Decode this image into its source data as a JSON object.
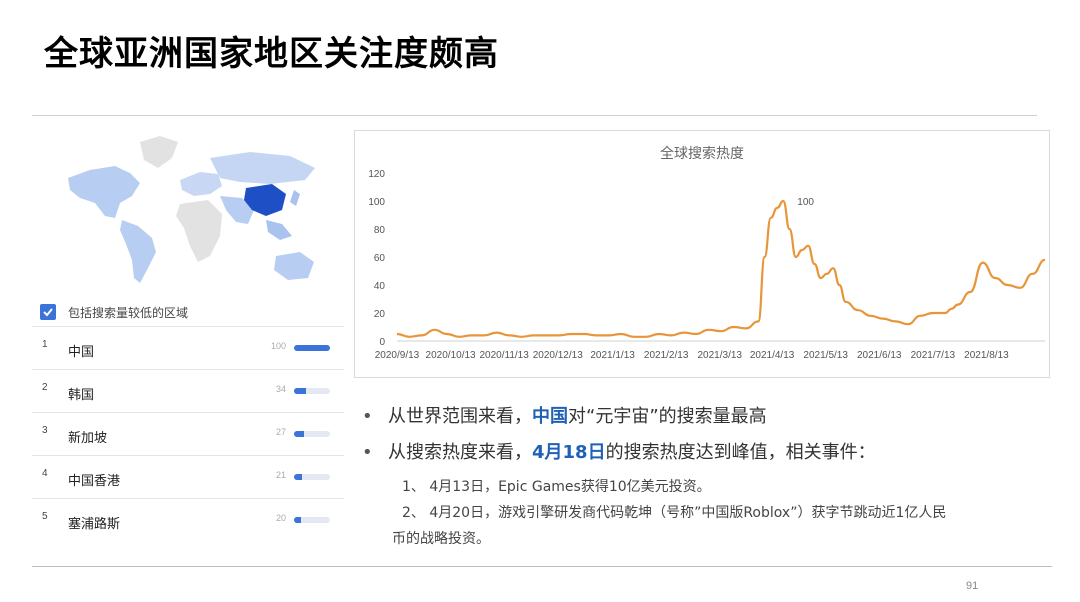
{
  "title": "全球亚洲国家地区关注度颇高",
  "page_number": "91",
  "colors": {
    "accent": "#2061b8",
    "bar": "#3b73d9",
    "line": "#e8953a",
    "china_map": "#1f4fc4"
  },
  "left_panel": {
    "checkbox_label": "包括搜索量较低的区域",
    "checkbox_checked": true,
    "rows": [
      {
        "rank": "1",
        "region": "中国",
        "value": "100",
        "fraction": 1.0
      },
      {
        "rank": "2",
        "region": "韩国",
        "value": "34",
        "fraction": 0.34
      },
      {
        "rank": "3",
        "region": "新加坡",
        "value": "27",
        "fraction": 0.27
      },
      {
        "rank": "4",
        "region": "中国香港",
        "value": "21",
        "fraction": 0.21
      },
      {
        "rank": "5",
        "region": "塞浦路斯",
        "value": "20",
        "fraction": 0.2
      }
    ]
  },
  "chart_data": {
    "type": "line",
    "title": "全球搜索热度",
    "ylim": [
      0,
      120
    ],
    "yticks": [
      0,
      20,
      40,
      60,
      80,
      100,
      120
    ],
    "xtick_labels": [
      "2020/9/13",
      "2020/10/13",
      "2020/11/13",
      "2020/12/13",
      "2021/1/13",
      "2021/2/13",
      "2021/3/13",
      "2021/4/13",
      "2021/5/13",
      "2021/6/13",
      "2021/7/13",
      "2021/8/13"
    ],
    "xtick_positions": [
      0,
      4.3,
      8.6,
      12.9,
      17.3,
      21.6,
      25.9,
      30.1,
      34.4,
      38.7,
      43.0,
      47.3
    ],
    "peak_label": "100",
    "x": [
      0,
      1,
      2,
      3,
      4,
      5,
      6,
      7,
      8,
      9,
      10,
      11,
      12,
      13,
      14,
      15,
      16,
      17,
      18,
      19,
      20,
      21,
      22,
      23,
      24,
      25,
      26,
      27,
      28,
      29,
      29.5,
      30,
      30.5,
      31,
      31.5,
      32,
      32.5,
      33,
      33.5,
      34,
      34.5,
      35,
      35.5,
      36,
      37,
      38,
      39,
      40,
      41,
      42,
      43,
      44,
      44.5,
      45,
      46,
      47,
      48,
      49,
      50,
      51,
      52
    ],
    "values": [
      5,
      3,
      4,
      8,
      5,
      3,
      4,
      4,
      6,
      4,
      3,
      4,
      4,
      4,
      5,
      5,
      4,
      4,
      5,
      3,
      3,
      5,
      4,
      6,
      5,
      8,
      7,
      10,
      9,
      14,
      60,
      88,
      95,
      100,
      80,
      60,
      65,
      68,
      55,
      45,
      48,
      52,
      40,
      28,
      22,
      18,
      16,
      14,
      12,
      18,
      20,
      20,
      23,
      26,
      35,
      56,
      45,
      40,
      38,
      48,
      58,
      55,
      48
    ]
  },
  "bullets": {
    "b1": {
      "pre": "从世界范围来看，",
      "hl": "中国",
      "post": "对“元宇宙”的搜索量最高"
    },
    "b2": {
      "pre": "从搜索热度来看，",
      "hl": "4月18日",
      "post": "的搜索热度达到峰值，相关事件："
    },
    "sub1": "1、 4月13日，Epic Games获得10亿美元投资。",
    "sub2a": "2、 4月20日，游戏引擎研发商代码乾坤（号称”中国版Roblox”）获字节跳动近1亿人民",
    "sub2b": "币的战略投资。"
  }
}
